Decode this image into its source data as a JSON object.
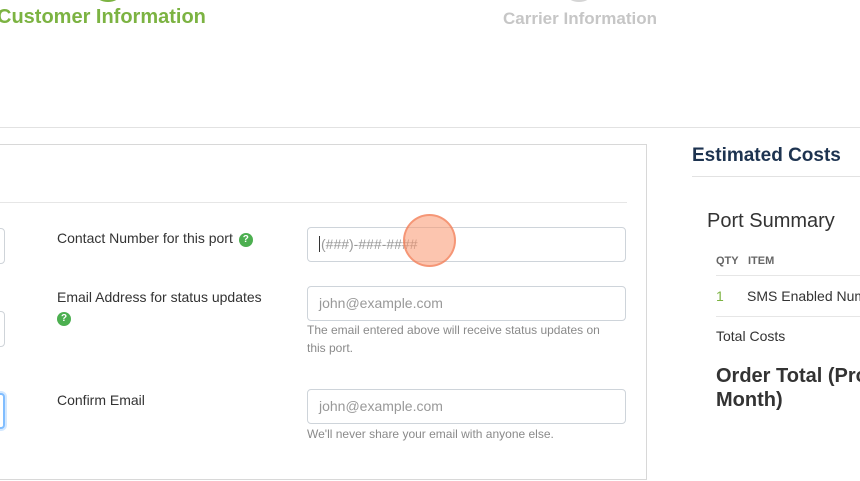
{
  "stepper": {
    "steps": [
      {
        "label": "Customer Information",
        "state": "active"
      },
      {
        "label": "Carrier Information",
        "state": "inactive"
      }
    ]
  },
  "form": {
    "contact_number": {
      "label": "Contact Number for this port",
      "placeholder": "(###)-###-####"
    },
    "email_status": {
      "label": "Email Address for status updates",
      "placeholder": "john@example.com",
      "help_text": "The email entered above will receive status updates on this port."
    },
    "confirm_email": {
      "label": "Confirm Email",
      "placeholder": "john@example.com",
      "help_text": "We'll never share your email with anyone else."
    },
    "help_icon_glyph": "?"
  },
  "sidebar": {
    "title": "Estimated Costs",
    "summary_title": "Port Summary",
    "columns": {
      "qty": "QTY",
      "item": "ITEM"
    },
    "rows": [
      {
        "qty": "1",
        "item": "SMS Enabled Num"
      }
    ],
    "total_costs_label": "Total Costs",
    "order_total_label": "Order Total (Pro Month)"
  },
  "colors": {
    "accent_green": "#7cb342",
    "heading_navy": "#1d3350",
    "help_icon_green": "#4caf50",
    "focus_blue": "#80bdff",
    "click_marker": "#f8956e"
  }
}
